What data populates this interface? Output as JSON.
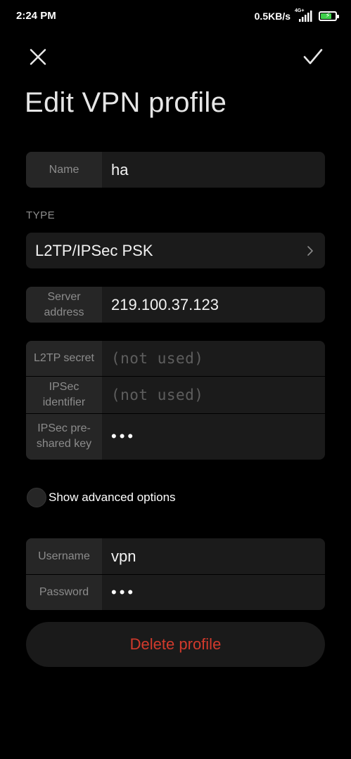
{
  "status_bar": {
    "time": "2:24 PM",
    "net_speed": "0.5KB/s",
    "network_type": "4G+",
    "battery_icon": "battery-charging-icon",
    "battery_level": 0.7
  },
  "toolbar": {
    "close_icon": "close-icon",
    "confirm_icon": "checkmark-icon"
  },
  "title": "Edit VPN profile",
  "name_field": {
    "label": "Name",
    "value": "ha"
  },
  "type_section": {
    "label": "TYPE",
    "value": "L2TP/IPSec PSK",
    "icon": "chevron-right-icon"
  },
  "server_field": {
    "label": "Server address",
    "value": "219.100.37.123"
  },
  "l2tp_fields": {
    "l2tp_secret": {
      "label": "L2TP secret",
      "placeholder": "(not used)"
    },
    "ipsec_identifier": {
      "label": "IPSec identifier",
      "placeholder": "(not used)"
    },
    "ipsec_psk": {
      "label": "IPSec pre-shared key",
      "value": "•••"
    }
  },
  "advanced": {
    "label": "Show advanced options"
  },
  "credentials": {
    "username": {
      "label": "Username",
      "value": "vpn"
    },
    "password": {
      "label": "Password",
      "value": "•••"
    }
  },
  "delete_button": {
    "label": "Delete profile"
  },
  "colors": {
    "background": "#000000",
    "card": "#1b1b1b",
    "label_cell": "#262626",
    "danger": "#d23a2c",
    "battery_fill": "#3ecf4a"
  }
}
